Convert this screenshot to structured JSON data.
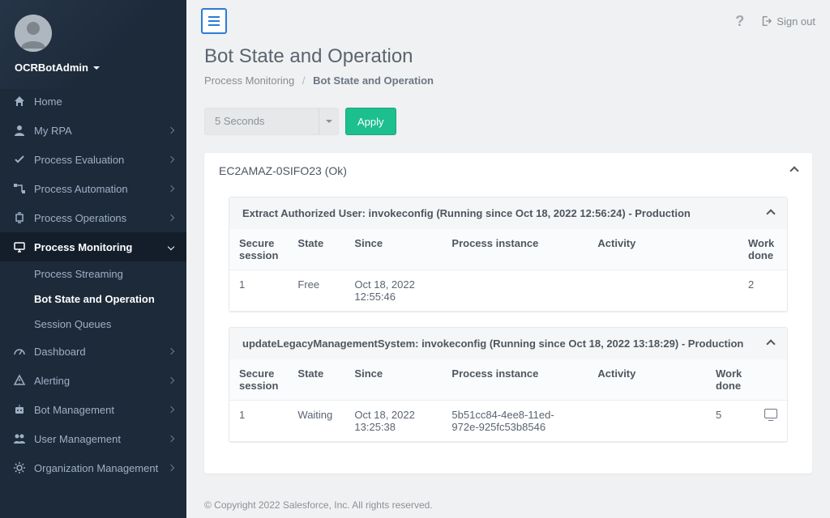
{
  "user": {
    "name": "OCRBotAdmin"
  },
  "top": {
    "help_icon": "?",
    "signout_label": "Sign out"
  },
  "page": {
    "title": "Bot State and Operation",
    "breadcrumb_parent": "Process Monitoring",
    "breadcrumb_current": "Bot State and Operation"
  },
  "refresh": {
    "value": "5 Seconds",
    "apply_label": "Apply"
  },
  "sidebar": {
    "items": [
      {
        "label": "Home",
        "expandable": false
      },
      {
        "label": "My RPA",
        "expandable": true
      },
      {
        "label": "Process Evaluation",
        "expandable": true
      },
      {
        "label": "Process Automation",
        "expandable": true
      },
      {
        "label": "Process Operations",
        "expandable": true
      },
      {
        "label": "Process Monitoring",
        "expandable": true,
        "active": true
      },
      {
        "label": "Dashboard",
        "expandable": true
      },
      {
        "label": "Alerting",
        "expandable": true
      },
      {
        "label": "Bot Management",
        "expandable": true
      },
      {
        "label": "User Management",
        "expandable": true
      },
      {
        "label": "Organization Management",
        "expandable": true
      }
    ],
    "subitems": [
      {
        "label": "Process Streaming"
      },
      {
        "label": "Bot State and Operation",
        "active": true
      },
      {
        "label": "Session Queues"
      }
    ]
  },
  "host_panel": {
    "title": "EC2AMAZ-0SIFO23 (Ok)"
  },
  "table_headers": {
    "session": "Secure session",
    "state": "State",
    "since": "Since",
    "instance": "Process instance",
    "activity": "Activity",
    "work": "Work done"
  },
  "processes": [
    {
      "title": "Extract Authorized User: invokeconfig (Running since Oct 18, 2022 12:56:24) - Production",
      "rows": [
        {
          "session": "1",
          "state": "Free",
          "since": "Oct 18, 2022 12:55:46",
          "instance": "",
          "activity": "",
          "work": "2",
          "has_action": false
        }
      ]
    },
    {
      "title": "updateLegacyManagementSystem: invokeconfig (Running since Oct 18, 2022 13:18:29) - Production",
      "rows": [
        {
          "session": "1",
          "state": "Waiting",
          "since": "Oct 18, 2022 13:25:38",
          "instance": "5b51cc84-4ee8-11ed-972e-925fc53b8546",
          "activity": "",
          "work": "5",
          "has_action": true
        }
      ]
    }
  ],
  "footer": "© Copyright 2022 Salesforce, Inc. All rights reserved."
}
